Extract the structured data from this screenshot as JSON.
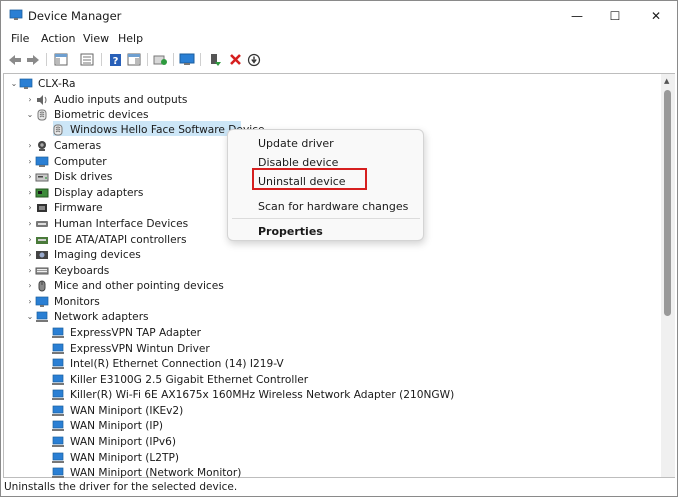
{
  "window": {
    "title": "Device Manager",
    "controls": {
      "minimize": "—",
      "maximize": "☐",
      "close": "✕"
    }
  },
  "menu": [
    "File",
    "Action",
    "View",
    "Help"
  ],
  "toolbar_icons": [
    "back-icon",
    "forward-icon",
    "show-hide-console-tree-icon",
    "properties-list-icon",
    "help-icon",
    "action-pane-icon",
    "update-driver-icon",
    "scan-hardware-icon",
    "enable-device-icon",
    "uninstall-device-icon",
    "disable-device-icon"
  ],
  "tree": [
    {
      "label": "CLX-Ra",
      "chevron": "⌄",
      "icon": "computer-root-icon"
    },
    {
      "label": "Audio inputs and outputs",
      "chevron": "›",
      "icon": "audio-icon"
    },
    {
      "label": "Biometric devices",
      "chevron": "⌄",
      "icon": "biometric-icon"
    },
    {
      "label": "Windows Hello Face Software Device",
      "chevron": "",
      "icon": "biometric-device-icon",
      "selected": true
    },
    {
      "label": "Cameras",
      "chevron": "›",
      "icon": "camera-icon"
    },
    {
      "label": "Computer",
      "chevron": "›",
      "icon": "computer-icon"
    },
    {
      "label": "Disk drives",
      "chevron": "›",
      "icon": "disk-icon"
    },
    {
      "label": "Display adapters",
      "chevron": "›",
      "icon": "display-adapter-icon"
    },
    {
      "label": "Firmware",
      "chevron": "›",
      "icon": "firmware-icon"
    },
    {
      "label": "Human Interface Devices",
      "chevron": "›",
      "icon": "hid-icon"
    },
    {
      "label": "IDE ATA/ATAPI controllers",
      "chevron": "›",
      "icon": "ide-icon"
    },
    {
      "label": "Imaging devices",
      "chevron": "›",
      "icon": "imaging-icon"
    },
    {
      "label": "Keyboards",
      "chevron": "›",
      "icon": "keyboard-icon"
    },
    {
      "label": "Mice and other pointing devices",
      "chevron": "›",
      "icon": "mouse-icon"
    },
    {
      "label": "Monitors",
      "chevron": "›",
      "icon": "monitor-icon"
    },
    {
      "label": "Network adapters",
      "chevron": "⌄",
      "icon": "network-icon"
    },
    {
      "label": "ExpressVPN TAP Adapter",
      "chevron": "",
      "icon": "network-adapter-icon"
    },
    {
      "label": "ExpressVPN Wintun Driver",
      "chevron": "",
      "icon": "network-adapter-icon"
    },
    {
      "label": "Intel(R) Ethernet Connection (14) I219-V",
      "chevron": "",
      "icon": "network-adapter-icon"
    },
    {
      "label": "Killer E3100G 2.5 Gigabit Ethernet Controller",
      "chevron": "",
      "icon": "network-adapter-icon"
    },
    {
      "label": "Killer(R) Wi-Fi 6E AX1675x 160MHz Wireless Network Adapter (210NGW)",
      "chevron": "",
      "icon": "network-adapter-icon"
    },
    {
      "label": "WAN Miniport (IKEv2)",
      "chevron": "",
      "icon": "network-adapter-icon"
    },
    {
      "label": "WAN Miniport (IP)",
      "chevron": "",
      "icon": "network-adapter-icon"
    },
    {
      "label": "WAN Miniport (IPv6)",
      "chevron": "",
      "icon": "network-adapter-icon"
    },
    {
      "label": "WAN Miniport (L2TP)",
      "chevron": "",
      "icon": "network-adapter-icon"
    },
    {
      "label": "WAN Miniport (Network Monitor)",
      "chevron": "",
      "icon": "network-adapter-icon"
    }
  ],
  "context_menu": {
    "items": [
      "Update driver",
      "Disable device",
      "Uninstall device",
      "Scan for hardware changes",
      "Properties"
    ],
    "highlighted": "Uninstall device",
    "highlight_color": "#d61f1f"
  },
  "status": "Uninstalls the driver for the selected device.",
  "colors": {
    "selection": "#cce6f7",
    "icon_blue": "#1e7bd0",
    "delete_red": "#d61f1f",
    "add_green": "#2e9a3e"
  }
}
